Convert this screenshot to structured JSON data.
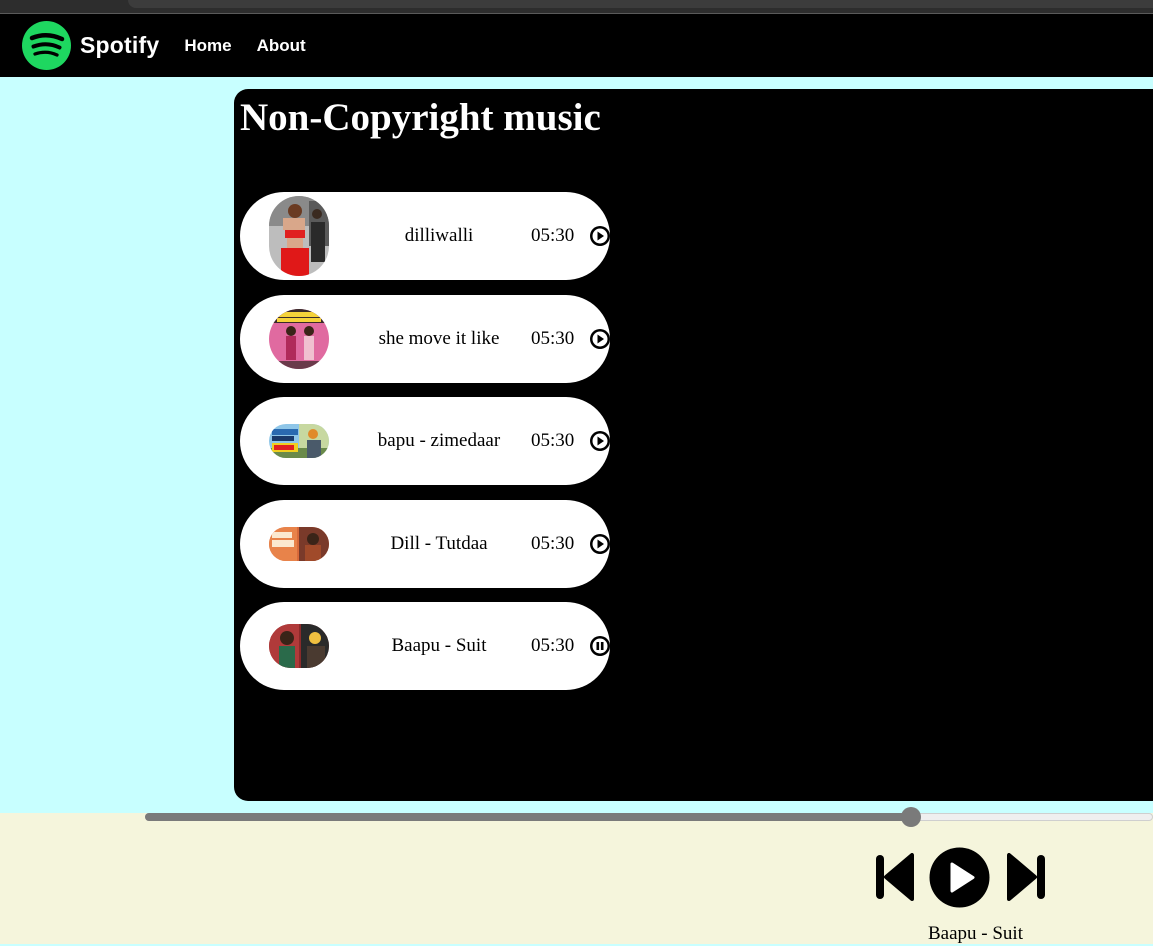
{
  "nav": {
    "brand": "Spotify",
    "links": [
      "Home",
      "About"
    ],
    "brand_color": "#1ed760"
  },
  "main": {
    "title": "Non-Copyright music",
    "songs": [
      {
        "name": "dilliwalli",
        "duration": "05:30",
        "state": "play"
      },
      {
        "name": "she move it like",
        "duration": "05:30",
        "state": "play"
      },
      {
        "name": "bapu - zimedaar",
        "duration": "05:30",
        "state": "play"
      },
      {
        "name": "Dill - Tutdaa",
        "duration": "05:30",
        "state": "play"
      },
      {
        "name": "Baapu - Suit",
        "duration": "05:30",
        "state": "pause"
      }
    ]
  },
  "player": {
    "progress_fraction": 0.76,
    "now_playing": "Baapu - Suit",
    "icons": [
      "previous-icon",
      "play-icon",
      "next-icon"
    ]
  },
  "colors": {
    "page_bg": "#c8ffff",
    "player_bg": "#f5f5dc",
    "panel_bg": "#000000"
  }
}
